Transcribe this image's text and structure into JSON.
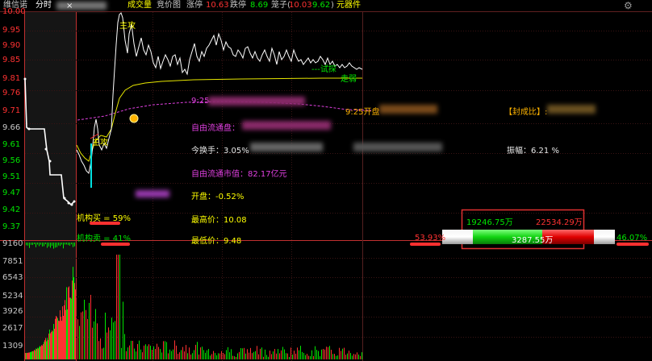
{
  "colors": {
    "up": "#ff3232",
    "down": "#00e600",
    "yellow": "#ffff00",
    "magenta": "#e040e0",
    "axis": "#c03030",
    "white": "#ffffff"
  },
  "header": {
    "stock_name": "维信诺",
    "tab_minute": "分时",
    "close_icon": "×",
    "volume_label": "成交量",
    "auction_label": "竞价图",
    "limit_up_label": "涨停",
    "limit_up_value": "10.63",
    "limit_down_label": "跌停",
    "limit_down_value": "8.69",
    "cage_label": "笼子(",
    "cage_high": "10.03",
    "cage_low": "9.62",
    "cage_close": ")",
    "sector": "元器件",
    "settings_icon": "gear-icon"
  },
  "price_axis": [
    "10.00",
    "9.95",
    "9.90",
    "9.85",
    "9.81",
    "9.76",
    "9.71",
    "9.66",
    "9.61",
    "9.56",
    "9.51",
    "9.47",
    "9.42",
    "9.37"
  ],
  "volume_axis": [
    "9160",
    "7851",
    "6543",
    "5234",
    "3926",
    "2617",
    "1309"
  ],
  "annotations": {
    "attack": "主攻",
    "attack2": "主攻",
    "probe": "---试探",
    "leave": "走弱",
    "inst_buy": "机构买 = 59%",
    "inst_sell": "机构卖 = 41%",
    "auction_925": "9:25",
    "auction_925_open": "9:25开盘",
    "seal_ratio": "【封成比】:",
    "free_float_vol": "自由流通盘：",
    "turnover": "今换手：3.05%",
    "amplitude": "振幅：6.21 %",
    "free_float_mv": "自由流通市值：82.17亿元",
    "open": "开盘：-0.52%",
    "high": "最高价：10.08",
    "low": "最低价：9.48"
  },
  "flow": {
    "buy_amount": "19246.75万",
    "sell_amount": "22534.29万",
    "net_amount": "3287.55万",
    "left_pct": "53.93%",
    "right_pct": "46.07%"
  }
}
